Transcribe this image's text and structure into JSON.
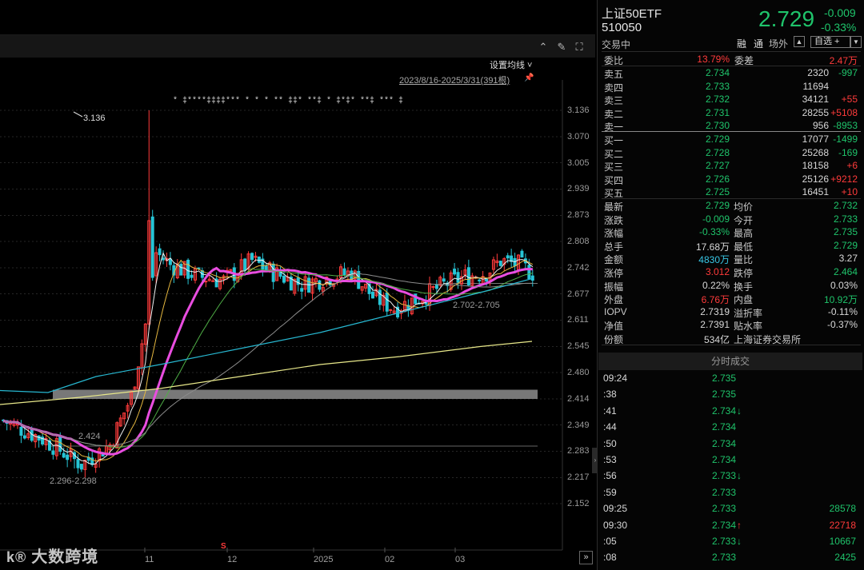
{
  "toolbar": {
    "ma_settings": "设置均线 ˅",
    "range": "2023/8/16-2025/3/31(391根)"
  },
  "chart_data": {
    "type": "candlestick",
    "y_ticks": [
      "3.136",
      "3.070",
      "3.005",
      "2.939",
      "2.873",
      "2.808",
      "2.742",
      "2.677",
      "2.611",
      "2.545",
      "2.480",
      "2.414",
      "2.349",
      "2.283",
      "2.217",
      "2.152"
    ],
    "x_ticks": [
      "11",
      "12",
      "2025",
      "02",
      "03"
    ],
    "ylim": [
      2.152,
      3.136
    ],
    "annotations": {
      "high_label": "3.136",
      "band_label": "2.424",
      "low_label": "2.296-2.298",
      "recent_label": "2.702-2.705"
    },
    "marker_row": "*  ‡****‡‡‡‡***  *  *      *  **         ‡‡*     **‡    *    ‡*‡*    **‡   ***    ‡",
    "ma_colors": {
      "white": "#f2f2f2",
      "yellow": "#e6b840",
      "magenta": "#e94de0",
      "green": "#4fae46",
      "gray": "#8c8c8c",
      "cyan": "#27b7d0",
      "lightyellow": "#e8e88a"
    },
    "series_up": "#ff3b3b",
    "series_down": "#27c5d6"
  },
  "watermark": {
    "logo": "k®",
    "text": "大数跨境"
  },
  "quote": {
    "name": "上证50ETF",
    "code": "510050",
    "status": "交易中",
    "last": "2.729",
    "chg": "-0.009",
    "chg_pct": "-0.33%",
    "tag_margin": "融",
    "tag_tong": "通",
    "tag_offex": "场外",
    "bell": "🔔",
    "watchlist": "自选 +",
    "watchlist_drop": "▼",
    "weibi_label": "委比",
    "weibi": "13.79%",
    "weicha_label": "委差",
    "weicha": "2.47万",
    "asks": [
      {
        "label": "卖五",
        "price": "2.734",
        "vol": "2320",
        "chg": "-997",
        "chg_color": "g"
      },
      {
        "label": "卖四",
        "price": "2.733",
        "vol": "11694",
        "chg": "",
        "chg_color": "w"
      },
      {
        "label": "卖三",
        "price": "2.732",
        "vol": "34121",
        "chg": "+55",
        "chg_color": "r"
      },
      {
        "label": "卖二",
        "price": "2.731",
        "vol": "28255",
        "chg": "+5108",
        "chg_color": "r"
      },
      {
        "label": "卖一",
        "price": "2.730",
        "vol": "956",
        "chg": "-8953",
        "chg_color": "g"
      }
    ],
    "bids": [
      {
        "label": "买一",
        "price": "2.729",
        "vol": "17077",
        "chg": "-1499",
        "chg_color": "g"
      },
      {
        "label": "买二",
        "price": "2.728",
        "vol": "25268",
        "chg": "-169",
        "chg_color": "g"
      },
      {
        "label": "买三",
        "price": "2.727",
        "vol": "18158",
        "chg": "+6",
        "chg_color": "r"
      },
      {
        "label": "买四",
        "price": "2.726",
        "vol": "25126",
        "chg": "+9212",
        "chg_color": "r"
      },
      {
        "label": "买五",
        "price": "2.725",
        "vol": "16451",
        "chg": "+10",
        "chg_color": "r"
      }
    ],
    "stats": [
      {
        "l1": "最新",
        "v1": "2.729",
        "c1": "g",
        "l2": "均价",
        "v2": "2.732",
        "c2": "g"
      },
      {
        "l1": "涨跌",
        "v1": "-0.009",
        "c1": "g",
        "l2": "今开",
        "v2": "2.733",
        "c2": "g"
      },
      {
        "l1": "涨幅",
        "v1": "-0.33%",
        "c1": "g",
        "l2": "最高",
        "v2": "2.735",
        "c2": "g"
      },
      {
        "l1": "总手",
        "v1": "17.68万",
        "c1": "w",
        "l2": "最低",
        "v2": "2.729",
        "c2": "g"
      },
      {
        "l1": "金额",
        "v1": "4830万",
        "c1": "c",
        "l2": "量比",
        "v2": "3.27",
        "c2": "w"
      },
      {
        "l1": "涨停",
        "v1": "3.012",
        "c1": "r",
        "l2": "跌停",
        "v2": "2.464",
        "c2": "g"
      },
      {
        "l1": "振幅",
        "v1": "0.22%",
        "c1": "w",
        "l2": "换手",
        "v2": "0.03%",
        "c2": "w"
      },
      {
        "l1": "外盘",
        "v1": "6.76万",
        "c1": "r",
        "l2": "内盘",
        "v2": "10.92万",
        "c2": "g"
      },
      {
        "l1": "IOPV",
        "v1": "2.7319",
        "c1": "w",
        "l2": "溢折率",
        "v2": "-0.11%",
        "c2": "w"
      },
      {
        "l1": "净值",
        "v1": "2.7391",
        "c1": "w",
        "l2": "贴水率",
        "v2": "-0.37%",
        "c2": "w"
      },
      {
        "l1": "份额",
        "v1": "534亿",
        "c1": "w",
        "l2": "上海证券交易所",
        "v2": "",
        "c2": "w"
      }
    ],
    "ticks_header": "分时成交",
    "ticks": [
      {
        "time": "09:24",
        "price": "2.735",
        "arrow": "",
        "vol": ""
      },
      {
        "time": ":38",
        "price": "2.735",
        "arrow": "",
        "vol": ""
      },
      {
        "time": ":41",
        "price": "2.734",
        "arrow": "↓",
        "vol": ""
      },
      {
        "time": ":44",
        "price": "2.734",
        "arrow": "",
        "vol": ""
      },
      {
        "time": ":50",
        "price": "2.734",
        "arrow": "",
        "vol": ""
      },
      {
        "time": ":53",
        "price": "2.734",
        "arrow": "",
        "vol": ""
      },
      {
        "time": ":56",
        "price": "2.733",
        "arrow": "↓",
        "vol": ""
      },
      {
        "time": ":59",
        "price": "2.733",
        "arrow": "",
        "vol": ""
      },
      {
        "time": "09:25",
        "price": "2.733",
        "arrow": "",
        "vol": "28578"
      },
      {
        "time": "09:30",
        "price": "2.734",
        "arrow": "↑",
        "vol": "22718"
      },
      {
        "time": ":05",
        "price": "2.733",
        "arrow": "↓",
        "vol": "10667"
      },
      {
        "time": ":08",
        "price": "2.733",
        "arrow": "",
        "vol": "2425"
      }
    ]
  }
}
